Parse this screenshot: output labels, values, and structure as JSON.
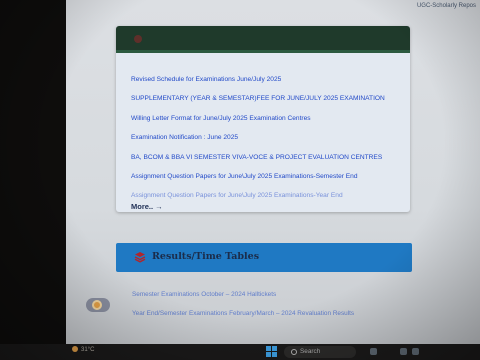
{
  "browser": {
    "top_link": "UGC-Scholarly Repos"
  },
  "notices": {
    "items": [
      "Revised Schedule for Examinations June/July 2025",
      "SUPPLEMENTARY (YEAR & SEMESTAR)FEE FOR JUNE/JULY 2025 EXAMINATION",
      "Willing Letter Format for June/July 2025 Examination Centres",
      "Examination Notification : June 2025",
      "BA, BCOM & BBA VI SEMESTER VIVA-VOCE & PROJECT EVALUATION CENTRES",
      "Assignment Question Papers for June\\July 2025 Examinations-Semester End",
      "Assignment Question Papers for June\\July 2025 Examinations-Year End"
    ],
    "more_label": "More..",
    "more_arrow": "→"
  },
  "results": {
    "title": "Results/Time Tables",
    "icon": "layers-icon",
    "items": [
      "Semester Examinations October – 2024 Halltickets",
      "Year End/Semester Examinations February/March – 2024 Revaluation Results"
    ]
  },
  "taskbar": {
    "weather": "31°C",
    "search_label": "Search"
  },
  "colors": {
    "notice_link": "#2149c8",
    "header_green": "#1f3a2b",
    "results_banner": "#1f79c3",
    "results_title": "#1b2c4a"
  }
}
